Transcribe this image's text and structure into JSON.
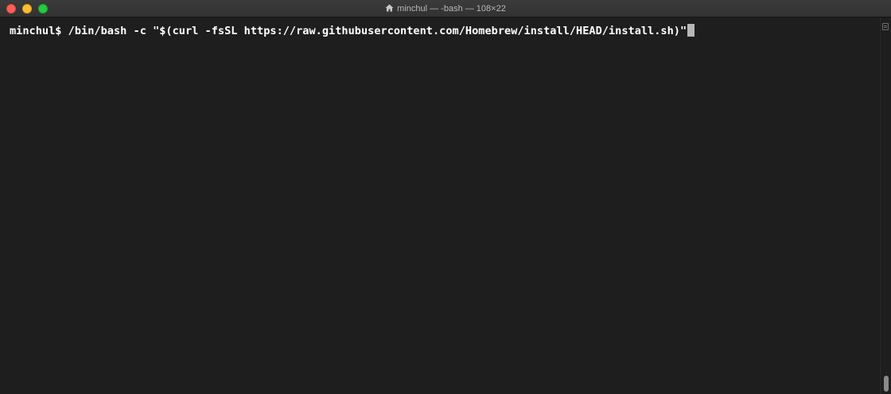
{
  "window": {
    "title": "minchul — -bash — 108×22",
    "title_icon": "home-icon"
  },
  "terminal": {
    "prompt": "minchul$ ",
    "command": "/bin/bash -c \"$(curl -fsSL https://raw.githubusercontent.com/Homebrew/install/HEAD/install.sh)\""
  },
  "colors": {
    "background": "#1e1e1e",
    "text": "#ffffff",
    "cursor": "#b7b7b7",
    "close": "#fe5f57",
    "minimize": "#febc2e",
    "zoom": "#28c840"
  }
}
